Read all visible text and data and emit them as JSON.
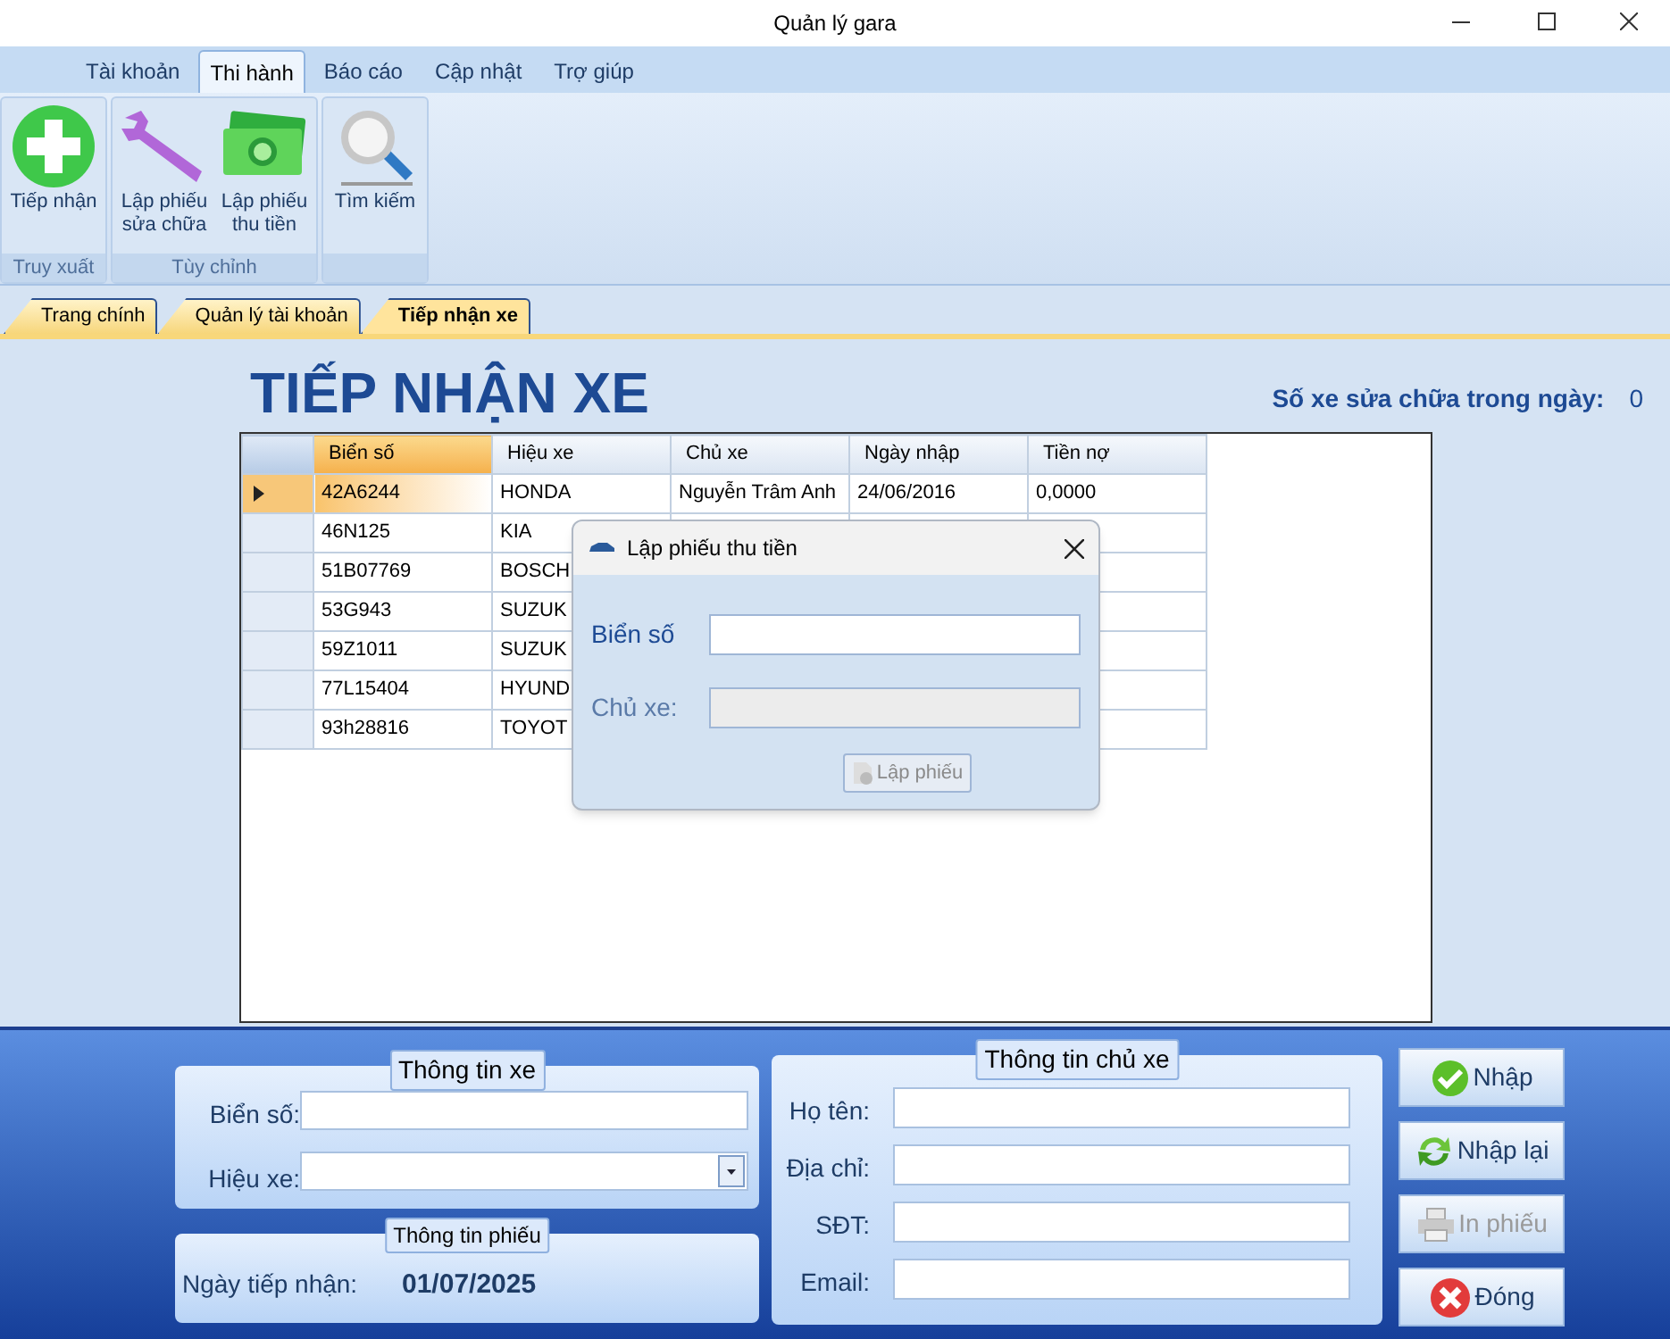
{
  "window": {
    "title": "Quản lý gara"
  },
  "ribbon_tabs": [
    {
      "label": "Tài khoản",
      "selected": false
    },
    {
      "label": "Thi hành",
      "selected": true
    },
    {
      "label": "Báo cáo",
      "selected": false
    },
    {
      "label": "Cập nhật",
      "selected": false
    },
    {
      "label": "Trợ giúp",
      "selected": false
    }
  ],
  "ribbon_groups": [
    {
      "label": "Truy xuất",
      "buttons": [
        {
          "label": "Tiếp nhận",
          "kind": "plus"
        }
      ]
    },
    {
      "label": "Tùy chỉnh",
      "buttons": [
        {
          "label": "Lập phiếu sửa chữa",
          "kind": "wrench"
        },
        {
          "label": "Lập phiếu thu tiền",
          "kind": "money"
        }
      ]
    },
    {
      "buttons": [
        {
          "label": "Tìm kiếm",
          "kind": "search"
        }
      ]
    }
  ],
  "doc_tabs": [
    {
      "label": "Trang chính",
      "selected": false
    },
    {
      "label": "Quản lý tài khoản",
      "selected": false
    },
    {
      "label": "Tiếp nhận xe",
      "selected": true
    }
  ],
  "heading": "TIẾP NHẬN XE",
  "daily_count": {
    "label": "Số xe sửa chữa trong ngày:",
    "value": "0"
  },
  "table": {
    "columns": [
      "Biển số",
      "Hiệu xe",
      "Chủ xe",
      "Ngày nhập",
      "Tiền nợ"
    ],
    "rows": [
      {
        "selected": true,
        "cells": [
          "42A6244",
          "HONDA",
          "Nguyễn Trâm Anh",
          "24/06/2016",
          "0,0000"
        ]
      },
      {
        "selected": false,
        "cells": [
          "46N125",
          "KIA"
        ]
      },
      {
        "selected": false,
        "cells": [
          "51B07769",
          "BOSCH"
        ]
      },
      {
        "selected": false,
        "cells": [
          "53G943",
          "SUZUK"
        ]
      },
      {
        "selected": false,
        "cells": [
          "59Z1011",
          "SUZUK"
        ]
      },
      {
        "selected": false,
        "cells": [
          "77L15404",
          "HYUND"
        ]
      },
      {
        "selected": false,
        "cells": [
          "93h28816",
          "TOYOT"
        ]
      }
    ]
  },
  "dialog": {
    "title": "Lập phiếu thu tiền",
    "fields": [
      {
        "label": "Biển số",
        "disabled": false
      },
      {
        "label": "Chủ xe:",
        "disabled": true
      }
    ],
    "button": {
      "label": "Lập phiếu",
      "disabled": true
    }
  },
  "vehicle_info": {
    "title": "Thông tin xe",
    "fields": [
      {
        "label": "Biển số:",
        "kind": "text"
      },
      {
        "label": "Hiệu xe:",
        "kind": "dropdown"
      }
    ]
  },
  "ticket_info": {
    "title": "Thông tin phiếu",
    "label": "Ngày tiếp nhận:",
    "value": "01/07/2025"
  },
  "owner_info": {
    "title": "Thông tin chủ xe",
    "fields": [
      {
        "label": "Họ tên:"
      },
      {
        "label": "Địa chỉ:"
      },
      {
        "label": "SĐT:"
      },
      {
        "label": "Email:"
      }
    ]
  },
  "actions": [
    {
      "label": "Nhập",
      "kind": "check",
      "disabled": false
    },
    {
      "label": "Nhập lại",
      "kind": "refresh",
      "disabled": false
    },
    {
      "label": "In phiếu",
      "kind": "print",
      "disabled": true
    },
    {
      "label": "Đóng",
      "kind": "close",
      "disabled": false
    }
  ]
}
